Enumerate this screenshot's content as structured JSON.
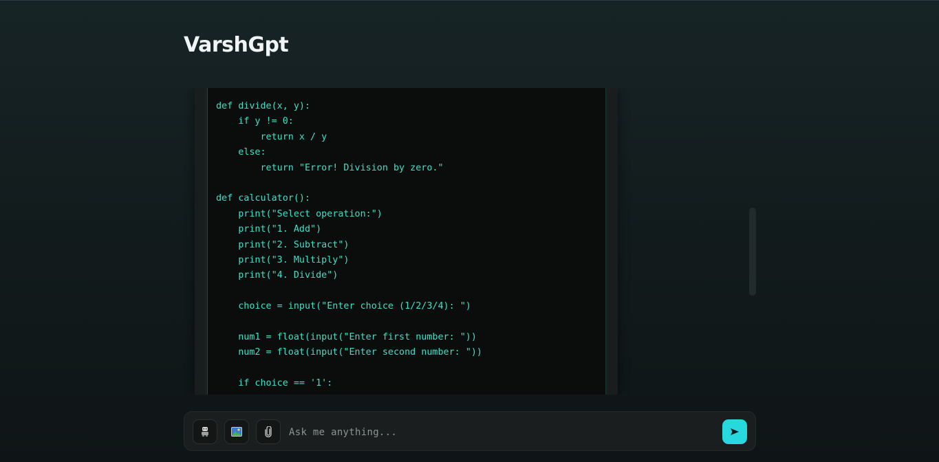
{
  "header": {
    "app_title": "VarshGpt"
  },
  "chat": {
    "code_lines": [
      "def divide(x, y):",
      "    if y != 0:",
      "        return x / y",
      "    else:",
      "        return \"Error! Division by zero.\"",
      "",
      "def calculator():",
      "    print(\"Select operation:\")",
      "    print(\"1. Add\")",
      "    print(\"2. Subtract\")",
      "    print(\"3. Multiply\")",
      "    print(\"4. Divide\")",
      "",
      "    choice = input(\"Enter choice (1/2/3/4): \")",
      "",
      "    num1 = float(input(\"Enter first number: \"))",
      "    num2 = float(input(\"Enter second number: \"))",
      "",
      "    if choice == '1':",
      ""
    ]
  },
  "composer": {
    "placeholder": "Ask me anything...",
    "value": "",
    "tools": [
      {
        "name": "robot-icon"
      },
      {
        "name": "image-icon"
      },
      {
        "name": "paperclip-icon"
      }
    ],
    "send_icon": "send-arrow-icon"
  },
  "colors": {
    "accent": "#27d9de",
    "code_text": "#3fe0c5",
    "background": "#121b1c"
  }
}
